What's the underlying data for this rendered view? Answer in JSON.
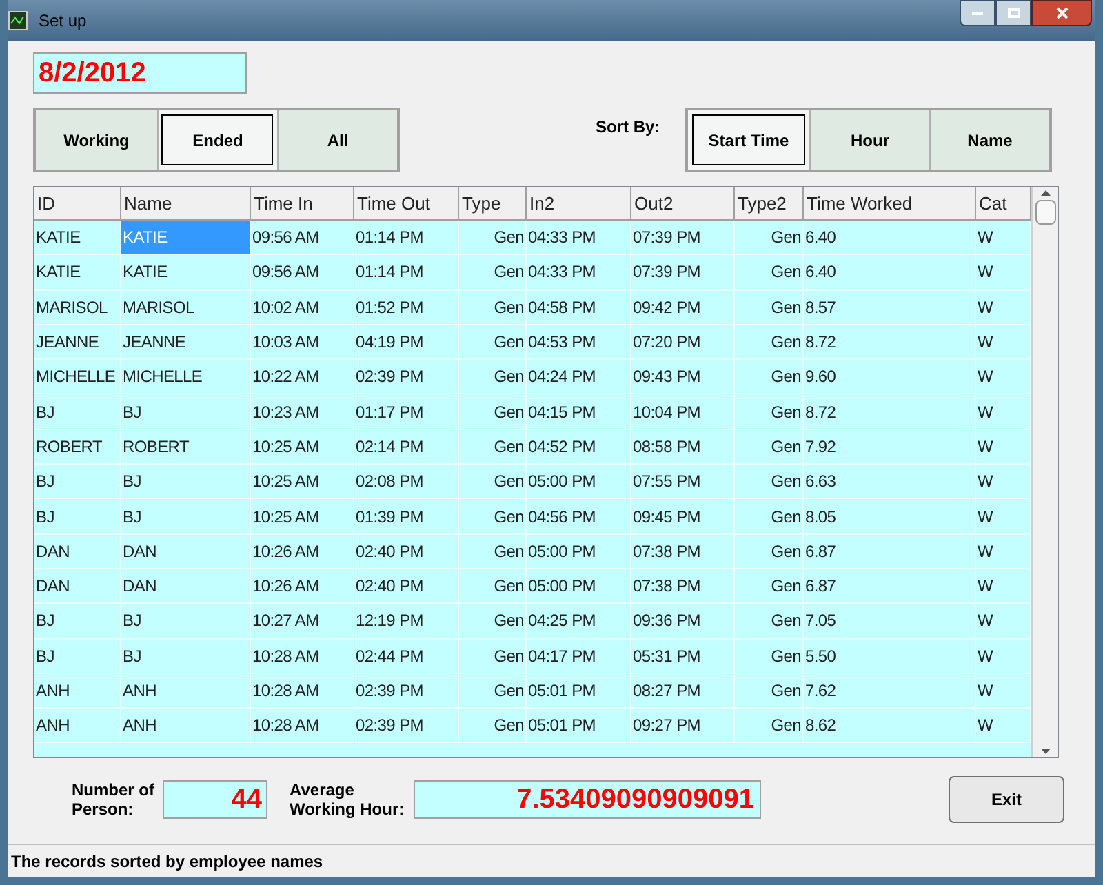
{
  "window": {
    "title": "Set up"
  },
  "date": "8/2/2012",
  "filters": [
    {
      "label": "Working",
      "selected": false
    },
    {
      "label": "Ended",
      "selected": true
    },
    {
      "label": "All",
      "selected": false
    }
  ],
  "sort_label": "Sort By:",
  "sort_options": [
    {
      "label": "Start Time",
      "selected": true
    },
    {
      "label": "Hour",
      "selected": false
    },
    {
      "label": "Name",
      "selected": false
    }
  ],
  "table": {
    "columns": [
      "ID",
      "Name",
      "Time In",
      "Time Out",
      "Type",
      "In2",
      "Out2",
      "Type2",
      "Time Worked",
      "Cat"
    ],
    "rows": [
      {
        "cells": [
          "KATIE",
          "KATIE",
          "09:56 AM",
          "01:14 PM",
          "Gen",
          "04:33 PM",
          "07:39 PM",
          "Gen",
          "6.40",
          "W"
        ],
        "selected": true
      },
      {
        "cells": [
          "KATIE",
          "KATIE",
          "09:56 AM",
          "01:14 PM",
          "Gen",
          "04:33 PM",
          "07:39 PM",
          "Gen",
          "6.40",
          "W"
        ],
        "selected": false
      },
      {
        "cells": [
          "MARISOL",
          "MARISOL",
          "10:02 AM",
          "01:52 PM",
          "Gen",
          "04:58 PM",
          "09:42 PM",
          "Gen",
          "8.57",
          "W"
        ],
        "selected": false
      },
      {
        "cells": [
          "JEANNE",
          "JEANNE",
          "10:03 AM",
          "04:19 PM",
          "Gen",
          "04:53 PM",
          "07:20 PM",
          "Gen",
          "8.72",
          "W"
        ],
        "selected": false
      },
      {
        "cells": [
          "MICHELLE",
          "MICHELLE",
          "10:22 AM",
          "02:39 PM",
          "Gen",
          "04:24 PM",
          "09:43 PM",
          "Gen",
          "9.60",
          "W"
        ],
        "selected": false
      },
      {
        "cells": [
          "BJ",
          "BJ",
          "10:23 AM",
          "01:17 PM",
          "Gen",
          "04:15 PM",
          "10:04 PM",
          "Gen",
          "8.72",
          "W"
        ],
        "selected": false
      },
      {
        "cells": [
          "ROBERT",
          "ROBERT",
          "10:25 AM",
          "02:14 PM",
          "Gen",
          "04:52 PM",
          "08:58 PM",
          "Gen",
          "7.92",
          "W"
        ],
        "selected": false
      },
      {
        "cells": [
          "BJ",
          "BJ",
          "10:25 AM",
          "02:08 PM",
          "Gen",
          "05:00 PM",
          "07:55 PM",
          "Gen",
          "6.63",
          "W"
        ],
        "selected": false
      },
      {
        "cells": [
          "BJ",
          "BJ",
          "10:25 AM",
          "01:39 PM",
          "Gen",
          "04:56 PM",
          "09:45 PM",
          "Gen",
          "8.05",
          "W"
        ],
        "selected": false
      },
      {
        "cells": [
          "DAN",
          "DAN",
          "10:26 AM",
          "02:40 PM",
          "Gen",
          "05:00 PM",
          "07:38 PM",
          "Gen",
          "6.87",
          "W"
        ],
        "selected": false
      },
      {
        "cells": [
          "DAN",
          "DAN",
          "10:26 AM",
          "02:40 PM",
          "Gen",
          "05:00 PM",
          "07:38 PM",
          "Gen",
          "6.87",
          "W"
        ],
        "selected": false
      },
      {
        "cells": [
          "BJ",
          "BJ",
          "10:27 AM",
          "12:19 PM",
          "Gen",
          "04:25 PM",
          "09:36 PM",
          "Gen",
          "7.05",
          "W"
        ],
        "selected": false
      },
      {
        "cells": [
          "BJ",
          "BJ",
          "10:28 AM",
          "02:44 PM",
          "Gen",
          "04:17 PM",
          "05:31 PM",
          "Gen",
          "5.50",
          "W"
        ],
        "selected": false
      },
      {
        "cells": [
          "ANH",
          "ANH",
          "10:28 AM",
          "02:39 PM",
          "Gen",
          "05:01 PM",
          "08:27 PM",
          "Gen",
          "7.62",
          "W"
        ],
        "selected": false
      },
      {
        "cells": [
          "ANH",
          "ANH",
          "10:28 AM",
          "02:39 PM",
          "Gen",
          "05:01 PM",
          "09:27 PM",
          "Gen",
          "8.62",
          "W"
        ],
        "selected": false
      }
    ]
  },
  "count": {
    "label": "Number of Person:",
    "value": "44"
  },
  "average": {
    "label": "Average Working Hour:",
    "value": "7.53409090909091"
  },
  "exit_button": "Exit",
  "status_bar": "The records sorted by employee names"
}
